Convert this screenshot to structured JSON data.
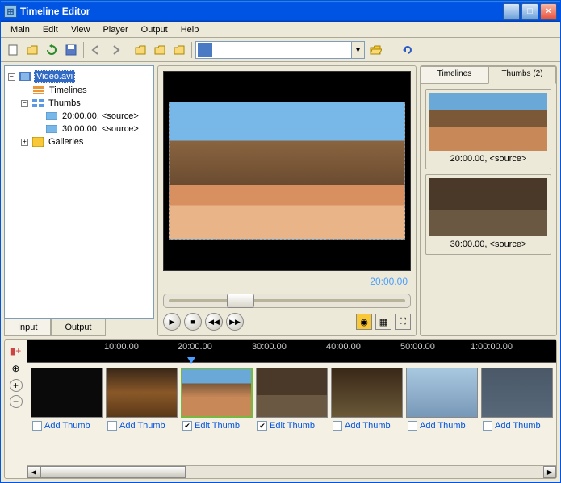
{
  "window": {
    "title": "Timeline Editor"
  },
  "menu": {
    "main": "Main",
    "edit": "Edit",
    "view": "View",
    "player": "Player",
    "output": "Output",
    "help": "Help"
  },
  "tree": {
    "root": "Video.avi",
    "timelines": "Timelines",
    "thumbs": "Thumbs",
    "thumb1": "20:00.00, <source>",
    "thumb2": "30:00.00, <source>",
    "galleries": "Galleries"
  },
  "tabs": {
    "input": "Input",
    "output": "Output"
  },
  "preview": {
    "timecode": "20:00.00"
  },
  "thumbs_panel": {
    "tab_timelines": "Timelines",
    "tab_thumbs": "Thumbs (2)",
    "items": [
      {
        "label": "20:00.00, <source>"
      },
      {
        "label": "30:00.00, <source>"
      }
    ]
  },
  "timeline": {
    "ticks": [
      "10:00.00",
      "20:00.00",
      "30:00.00",
      "40:00.00",
      "50:00.00",
      "1:00:00.00"
    ],
    "marker_time": "20:00.00",
    "clips": [
      {
        "checked": false,
        "action": "Add Thumb"
      },
      {
        "checked": false,
        "action": "Add Thumb"
      },
      {
        "checked": true,
        "action": "Edit Thumb"
      },
      {
        "checked": true,
        "action": "Edit Thumb"
      },
      {
        "checked": false,
        "action": "Add Thumb"
      },
      {
        "checked": false,
        "action": "Add Thumb"
      },
      {
        "checked": false,
        "action": "Add Thumb"
      }
    ]
  }
}
